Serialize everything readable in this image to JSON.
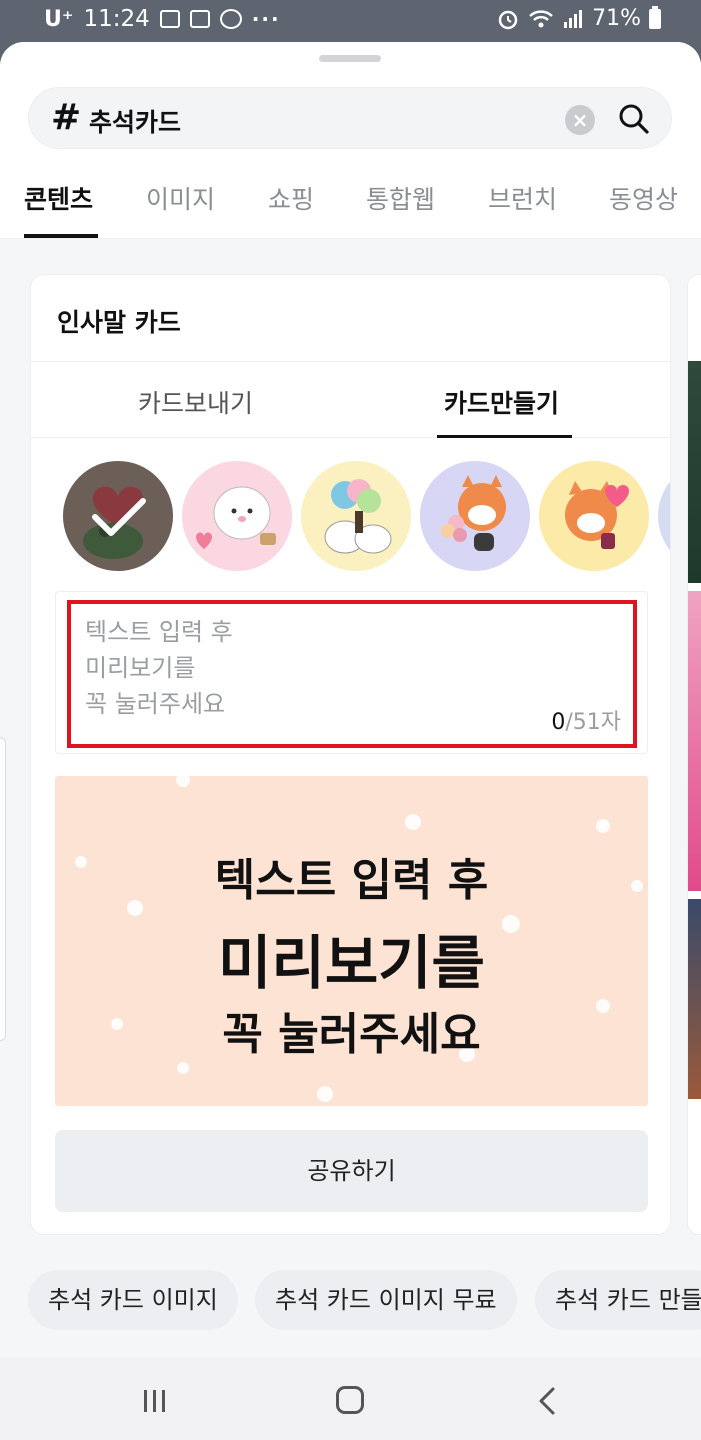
{
  "status_bar": {
    "carrier": "U⁺",
    "time": "11:24",
    "more": "···",
    "battery": "71%"
  },
  "search": {
    "hash": "#",
    "query": "추석카드",
    "clear_icon": "×"
  },
  "tabs": [
    {
      "label": "콘텐츠",
      "active": true
    },
    {
      "label": "이미지",
      "active": false
    },
    {
      "label": "쇼핑",
      "active": false
    },
    {
      "label": "통합웹",
      "active": false
    },
    {
      "label": "브런치",
      "active": false
    },
    {
      "label": "동영상",
      "active": false
    }
  ],
  "card": {
    "title": "인사말 카드",
    "inner_tabs": [
      {
        "label": "카드보내기",
        "active": false
      },
      {
        "label": "카드만들기",
        "active": true
      }
    ],
    "stickers": [
      {
        "name": "green-frog-heart-sticker",
        "selected": true
      },
      {
        "name": "white-mochi-sticker",
        "selected": false
      },
      {
        "name": "bouquet-birds-sticker",
        "selected": false
      },
      {
        "name": "red-panda-bouquet-sticker",
        "selected": false
      },
      {
        "name": "red-panda-heart-sticker",
        "selected": false
      }
    ],
    "input": {
      "placeholder_lines": [
        "텍스트 입력 후",
        "미리보기를",
        "꼭 눌러주세요"
      ],
      "count_current": "0",
      "count_max": "/51자"
    },
    "preview_lines": [
      "텍스트 입력 후",
      "미리보기를",
      "꼭 눌러주세요"
    ],
    "share_label": "공유하기"
  },
  "chips": [
    "추석 카드 이미지",
    "추석 카드 이미지 무료",
    "추석 카드 만들"
  ],
  "colors": {
    "highlight_border": "#e0141e",
    "preview_bg": "#fde3d3",
    "status_bar_bg": "#5f6570"
  },
  "icons": {
    "search": "search-icon",
    "clear": "clear-icon",
    "check": "check-icon",
    "nav_recents": "recents-icon",
    "nav_home": "home-icon",
    "nav_back": "back-icon"
  }
}
